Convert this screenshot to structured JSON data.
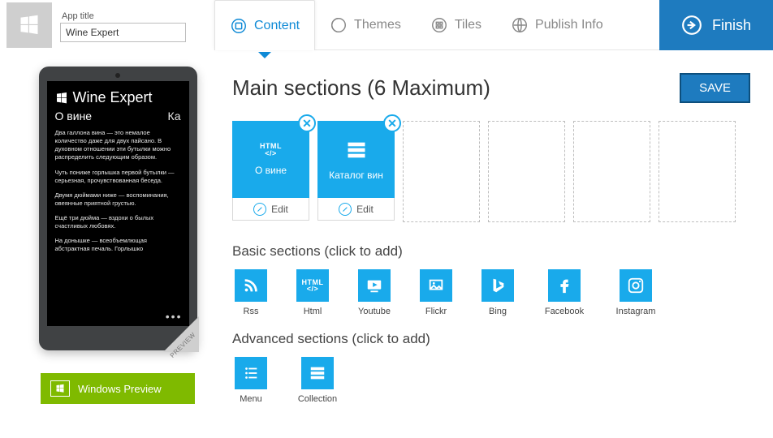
{
  "header": {
    "app_title_label": "App title",
    "app_title_value": "Wine Expert",
    "tabs": {
      "content": "Content",
      "themes": "Themes",
      "tiles": "Tiles",
      "publish": "Publish Info"
    },
    "finish": "Finish"
  },
  "preview": {
    "app_name": "Wine Expert",
    "section_visible": "О вине",
    "section_next_cut": "Ка",
    "paragraphs": [
      "Два галлона вина — это немалое количество даже для двух пайсано. В духовном отношении эти бутылки можно распределить следующим образом.",
      "Чуть пониже горлышка первой бутылки — серьезная, прочувствованная беседа.",
      "Двумя дюймами ниже — воспоминания, овеянные приятной грустью.",
      "Ещё три дюйма — вздохи о былых счастливых любовях.",
      "На донышке — всеобъемлющая абстрактная печаль. Горлышко"
    ],
    "corner_tag": "PREVIEW",
    "windows_preview_btn": "Windows Preview"
  },
  "editor": {
    "title": "Main sections (6 Maximum)",
    "save": "SAVE",
    "slots": [
      {
        "type": "html",
        "label": "О вине",
        "edit": "Edit"
      },
      {
        "type": "collection",
        "label": "Каталог вин",
        "edit": "Edit"
      }
    ],
    "basic_label": "Basic sections (click to add)",
    "basic": [
      {
        "id": "rss",
        "label": "Rss"
      },
      {
        "id": "html",
        "label": "Html"
      },
      {
        "id": "youtube",
        "label": "Youtube"
      },
      {
        "id": "flickr",
        "label": "Flickr"
      },
      {
        "id": "bing",
        "label": "Bing"
      },
      {
        "id": "facebook",
        "label": "Facebook"
      },
      {
        "id": "instagram",
        "label": "Instagram"
      }
    ],
    "advanced_label": "Advanced sections (click to add)",
    "advanced": [
      {
        "id": "menu",
        "label": "Menu"
      },
      {
        "id": "collection",
        "label": "Collection"
      }
    ]
  },
  "colors": {
    "accent": "#19aaeb",
    "primary": "#1e7bbf",
    "green": "#7fba00"
  }
}
